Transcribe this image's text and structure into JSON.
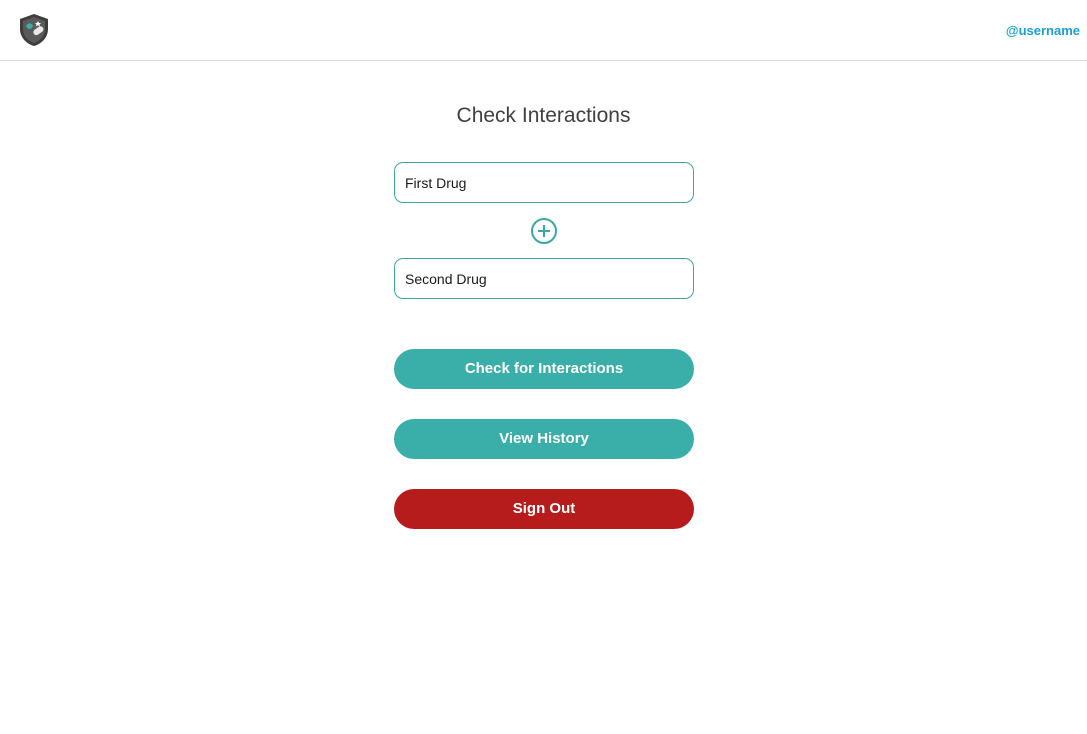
{
  "header": {
    "logo_icon": "shield-leaf-pill-icon",
    "username": "@username"
  },
  "main": {
    "title": "Check Interactions",
    "first_drug_placeholder": "First Drug",
    "first_drug_value": "",
    "add_icon": "plus-circle-icon",
    "second_drug_placeholder": "Second Drug",
    "second_drug_value": "",
    "check_label": "Check for Interactions",
    "history_label": "View History",
    "signout_label": "Sign Out"
  },
  "colors": {
    "accent": "#3aaea8",
    "danger": "#b71c1c",
    "link": "#1a9fd4",
    "text": "#404040"
  }
}
